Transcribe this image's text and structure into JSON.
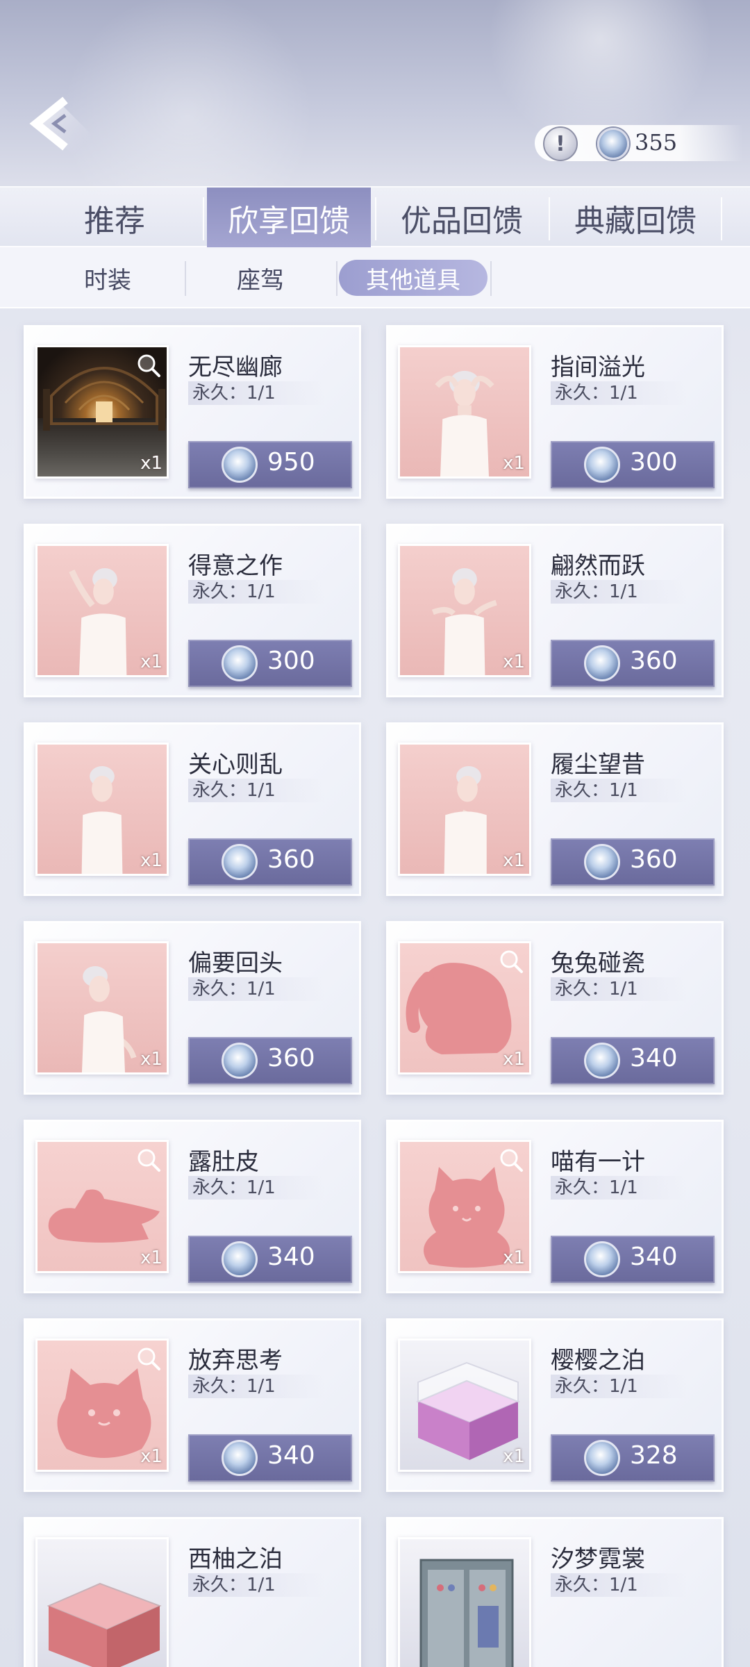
{
  "header": {
    "coin_balance": "355",
    "info_icon": "info-icon",
    "back_icon": "back-arrow-icon"
  },
  "main_tabs": [
    {
      "label": "推荐",
      "active": false
    },
    {
      "label": "欣享回馈",
      "active": true
    },
    {
      "label": "优品回馈",
      "active": false
    },
    {
      "label": "典藏回馈",
      "active": false
    }
  ],
  "sub_tabs": [
    {
      "label": "时装",
      "active": false
    },
    {
      "label": "座驾",
      "active": false
    },
    {
      "label": "其他道具",
      "active": true
    }
  ],
  "items": [
    {
      "name": "无尽幽廊",
      "duration": "永久：1/1",
      "price": "950",
      "qty": "x1",
      "art": "hall",
      "zoom": true
    },
    {
      "name": "指间溢光",
      "duration": "永久：1/1",
      "price": "300",
      "qty": "x1",
      "art": "girl",
      "zoom": false
    },
    {
      "name": "得意之作",
      "duration": "永久：1/1",
      "price": "300",
      "qty": "x1",
      "art": "girl",
      "zoom": false
    },
    {
      "name": "翩然而跃",
      "duration": "永久：1/1",
      "price": "360",
      "qty": "x1",
      "art": "girl",
      "zoom": false
    },
    {
      "name": "关心则乱",
      "duration": "永久：1/1",
      "price": "360",
      "qty": "x1",
      "art": "girl",
      "zoom": false
    },
    {
      "name": "履尘望昔",
      "duration": "永久：1/1",
      "price": "360",
      "qty": "x1",
      "art": "girl",
      "zoom": false
    },
    {
      "name": "偏要回头",
      "duration": "永久：1/1",
      "price": "360",
      "qty": "x1",
      "art": "girl",
      "zoom": false
    },
    {
      "name": "兔兔碰瓷",
      "duration": "永久：1/1",
      "price": "340",
      "qty": "x1",
      "art": "rabbit",
      "zoom": true
    },
    {
      "name": "露肚皮",
      "duration": "永久：1/1",
      "price": "340",
      "qty": "x1",
      "art": "lying",
      "zoom": true
    },
    {
      "name": "喵有一计",
      "duration": "永久：1/1",
      "price": "340",
      "qty": "x1",
      "art": "cat",
      "zoom": true
    },
    {
      "name": "放弃思考",
      "duration": "永久：1/1",
      "price": "340",
      "qty": "x1",
      "art": "catface",
      "zoom": true
    },
    {
      "name": "樱樱之泊",
      "duration": "永久：1/1",
      "price": "328",
      "qty": "x1",
      "art": "box",
      "zoom": false
    },
    {
      "name": "西柚之泊",
      "duration": "永久：1/1",
      "price": "",
      "qty": "",
      "art": "box2",
      "zoom": false
    },
    {
      "name": "汐梦霓裳",
      "duration": "永久：1/1",
      "price": "",
      "qty": "",
      "art": "wardrobe",
      "zoom": false
    }
  ]
}
